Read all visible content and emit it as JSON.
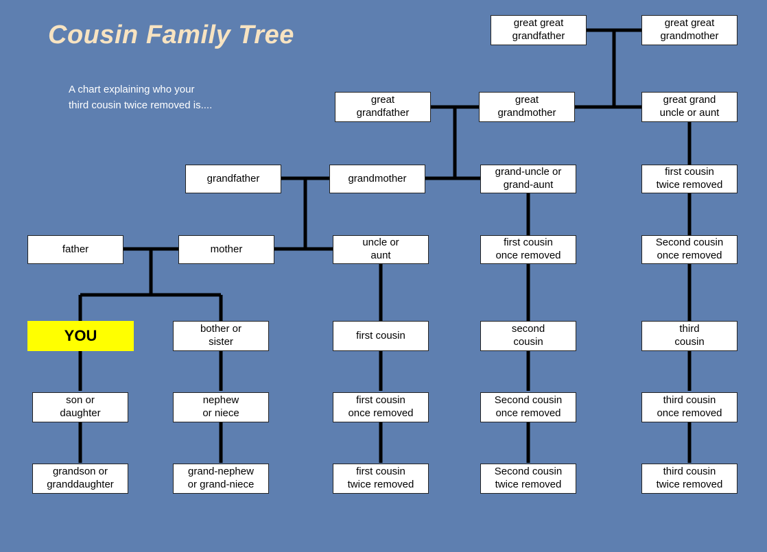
{
  "title": "Cousin Family Tree",
  "subtitle": "A chart explaining who your\nthird cousin twice removed is....",
  "nodes": {
    "gg_grandfather": "great great\ngrandfather",
    "gg_grandmother": "great great\ngrandmother",
    "great_grandfather": "great\ngrandfather",
    "great_grandmother": "great\ngrandmother",
    "great_grand_uncle": "great grand\nuncle or aunt",
    "grandfather": "grandfather",
    "grandmother": "grandmother",
    "grand_uncle": "grand-uncle or\ngrand-aunt",
    "fc_twice_removed_top": "first cousin\ntwice removed",
    "father": "father",
    "mother": "mother",
    "uncle_aunt": "uncle or\naunt",
    "fc_once_removed_top": "first cousin\nonce removed",
    "sc_once_removed_top": "Second cousin\nonce removed",
    "you": "YOU",
    "sibling": "bother or\nsister",
    "first_cousin": "first cousin",
    "second_cousin": "second\ncousin",
    "third_cousin": "third\ncousin",
    "son_daughter": "son or\ndaughter",
    "nephew_niece": "nephew\nor niece",
    "fc_once_removed_low": "first cousin\nonce removed",
    "sc_once_removed_low": "Second cousin\nonce removed",
    "tc_once_removed": "third cousin\nonce removed",
    "grandson": "grandson or\ngranddaughter",
    "grand_nephew": "grand-nephew\nor grand-niece",
    "fc_twice_removed_low": "first cousin\ntwice removed",
    "sc_twice_removed": "Second cousin\ntwice removed",
    "tc_twice_removed": "third cousin\ntwice removed"
  }
}
